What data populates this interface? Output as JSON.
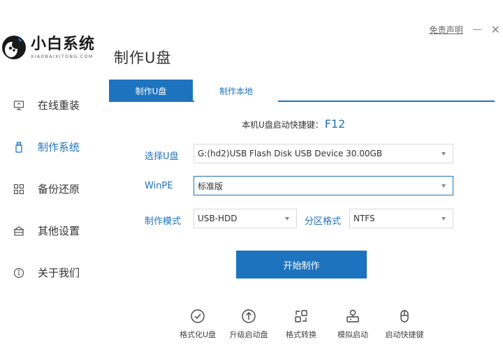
{
  "app": {
    "logo_title": "小白系统",
    "logo_subtitle": "XIAOBAIXITONG.COM",
    "page_title": "制作U盘",
    "disclaimer": "免责声明",
    "accent_color": "#1e73be"
  },
  "window_controls": {
    "minimize_icon": "minimize-icon",
    "close_icon": "close-icon",
    "close_glyph": "✕"
  },
  "sidebar": {
    "items": [
      {
        "label": "在线重装",
        "icon": "monitor-icon",
        "active": false
      },
      {
        "label": "制作系统",
        "icon": "usb-drive-icon",
        "active": true
      },
      {
        "label": "备份还原",
        "icon": "grid-icon",
        "active": false
      },
      {
        "label": "其他设置",
        "icon": "box-icon",
        "active": false
      },
      {
        "label": "关于我们",
        "icon": "info-icon",
        "active": false
      }
    ]
  },
  "tabs": [
    {
      "label": "制作U盘",
      "active": true
    },
    {
      "label": "制作本地",
      "active": false
    }
  ],
  "hotkey": {
    "label": "本机U盘启动快捷键：",
    "key": "F12"
  },
  "form": {
    "usb_label": "选择U盘",
    "usb_value": "G:(hd2)USB Flash Disk USB Device 30.00GB",
    "winpe_label": "WinPE",
    "winpe_value": "标准版",
    "mode_label": "制作模式",
    "mode_value": "USB-HDD",
    "partition_label": "分区格式",
    "partition_value": "NTFS"
  },
  "start_button": "开始制作",
  "tools": [
    {
      "label": "格式化U盘",
      "icon": "check-circle-icon"
    },
    {
      "label": "升级启动盘",
      "icon": "upload-circle-icon"
    },
    {
      "label": "格式转换",
      "icon": "convert-icon"
    },
    {
      "label": "模拟启动",
      "icon": "simulate-icon"
    },
    {
      "label": "启动快捷键",
      "icon": "mouse-icon"
    }
  ]
}
